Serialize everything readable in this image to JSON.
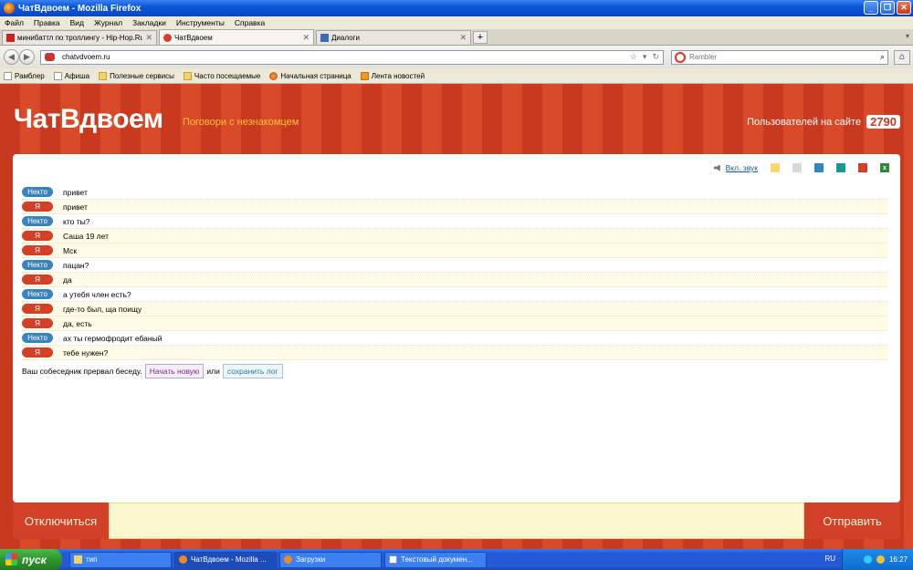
{
  "window": {
    "title": "ЧатВдвоем - Mozilla Firefox"
  },
  "menu": [
    "Файл",
    "Правка",
    "Вид",
    "Журнал",
    "Закладки",
    "Инструменты",
    "Справка"
  ],
  "tabs": [
    {
      "label": "минибаттл по троллингу - Hip-Hop.Ru",
      "active": false
    },
    {
      "label": "ЧатВдвоем",
      "active": true
    },
    {
      "label": "Диалоги",
      "active": false
    }
  ],
  "nav": {
    "url": "chatvdvoem.ru",
    "search_placeholder": "Rambler"
  },
  "bookmarks": [
    {
      "label": "Рамблер",
      "icon": "page-icon"
    },
    {
      "label": "Афиша",
      "icon": "page-icon"
    },
    {
      "label": "Полезные сервисы",
      "icon": "folder-icon"
    },
    {
      "label": "Часто посещаемые",
      "icon": "folder-icon"
    },
    {
      "label": "Начальная страница",
      "icon": "firefox-icon"
    },
    {
      "label": "Лента новостей",
      "icon": "rss-icon"
    }
  ],
  "site": {
    "logo": "ЧатВдвоем",
    "tagline": "Поговори с незнакомцем",
    "users_label": "Пользователей на сайте",
    "users_count": "2790",
    "sound_label": "Вкл. звук",
    "themes": [
      "#f5d870",
      "#d8d8d8",
      "#2f86c0",
      "#1c9a92",
      "#d2402a"
    ],
    "accent": "#d2402a"
  },
  "chat": {
    "messages": [
      {
        "who": "Некто",
        "text": "привет"
      },
      {
        "who": "Я",
        "text": "привет"
      },
      {
        "who": "Некто",
        "text": "кто ты?"
      },
      {
        "who": "Я",
        "text": "Саша 19 лет"
      },
      {
        "who": "Я",
        "text": "Мск"
      },
      {
        "who": "Некто",
        "text": "пацан?"
      },
      {
        "who": "Я",
        "text": "да"
      },
      {
        "who": "Некто",
        "text": "а утебя член есть?"
      },
      {
        "who": "Я",
        "text": "где-то был, ща поищу"
      },
      {
        "who": "Я",
        "text": "да, есть"
      },
      {
        "who": "Некто",
        "text": "ах ты гермофродит ебаный"
      },
      {
        "who": "Я",
        "text": "тебе нужен?"
      }
    ],
    "ended_text": "Ваш собеседник прервал беседу.",
    "new_chat_label": "Начать новую",
    "or_label": "или",
    "save_log_label": "сохранить лог"
  },
  "controls": {
    "disconnect_label": "Отключиться",
    "send_label": "Отправить"
  },
  "taskbar": {
    "start_label": "пуск",
    "tasks": [
      {
        "label": "тип",
        "active": false
      },
      {
        "label": "ЧатВдвоем - Mozilla ...",
        "active": true
      },
      {
        "label": "Загрузки",
        "active": false
      },
      {
        "label": "Текстовый докумен...",
        "active": false
      }
    ],
    "lang": "RU",
    "time": "16:27"
  }
}
